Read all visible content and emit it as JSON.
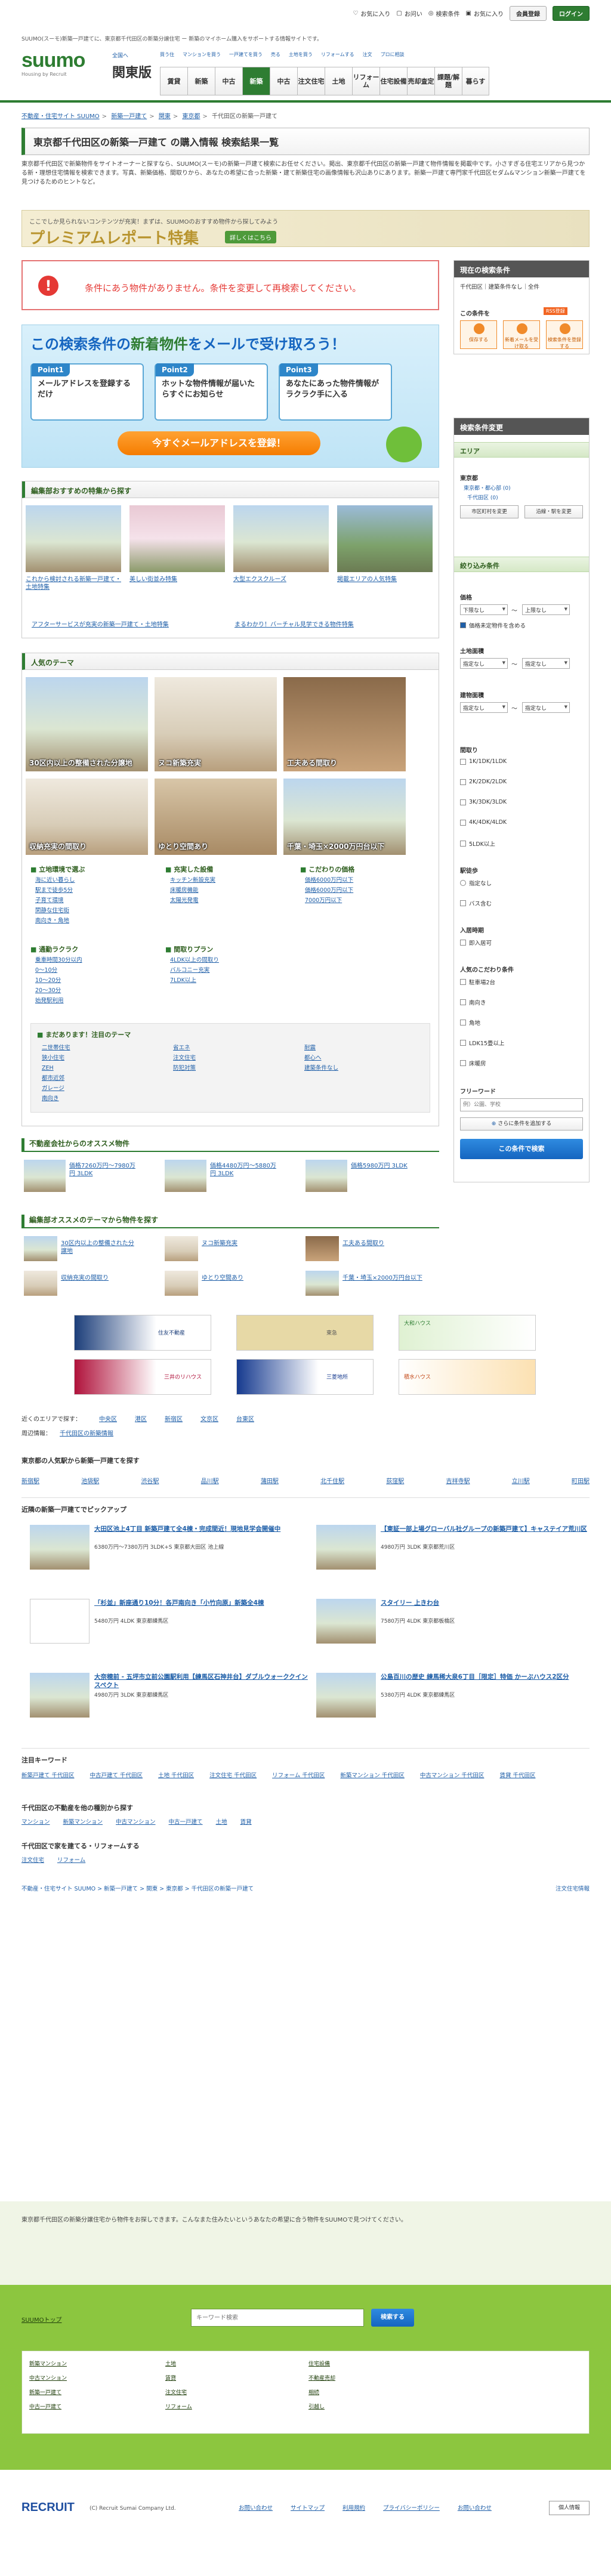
{
  "header": {
    "desc": "SUUMO(スーモ)新築一戸建てに、東京都千代田区の新築分譲住宅 ー 新築のマイホーム購入をサポートする情報サイトです。",
    "logo": "suumo",
    "logo_sub": "Housing by Recruit",
    "area_change": "全国へ",
    "area": "関東版",
    "links": [
      {
        "icon": "○",
        "label": "お気に入り"
      },
      {
        "icon": "□",
        "label": "お问い"
      },
      {
        "icon": "◎",
        "label": "検索条件"
      },
      {
        "icon": "▣",
        "label": "お気に入り"
      }
    ],
    "login_register": "会員登録",
    "login": "ログイン",
    "nav_top": [
      "買う住",
      "マンションを買う",
      "一戸建てを買う",
      "売る",
      "土地を買う",
      "リフォームする",
      "注文",
      "プロに相談"
    ],
    "nav": [
      "賃貸",
      "新築",
      "中古",
      "新築",
      "中古",
      "注文住宅",
      "土地",
      "リフォーム",
      "住宅設備",
      "売却査定",
      "課題/解題",
      "暮らす"
    ]
  },
  "breadcrumb": [
    "不動産・住宅サイト SUUMO",
    "新築一戸建て",
    "関東",
    "東京都",
    "千代田区の新築一戸建て"
  ],
  "title": "東京都千代田区の新築一戸建て の購入情報 検索結果一覧",
  "intro": "東京都千代田区で新築物件をサイトオーナーと探すなら、SUUMO(スーモ)の新築一戸建て検索にお任せください。掲出、東京都千代田区の新築一戸建て物件情報を掲載中です。小さすぎる住宅エリアから見つかる新・理想住宅情報を検索できます。写真、新築価格、間取りから、あなたの希望に合った新築・建て新築住宅の画像情報も沢山ありにあります。新築一戸建て専門家千代田区セダム&マンション新築一戸建てを見つけるためのヒントなど。",
  "premium": {
    "small": "ここでしか見られないコンテンツが充実！まずは、SUUMOのおすすめ物件から探してみよう",
    "big": "プレミアムレポート特集",
    "btn": "詳しくはこちら"
  },
  "warning": "条件にあう物件がありません。条件を変更して再検索してください。",
  "mail": {
    "title_a": "この検索条件の",
    "title_b": "新着物件",
    "title_c": "を",
    "title_d": "メール",
    "title_e": "で受け取ろう！",
    "points": [
      {
        "n": "Point1",
        "t": "メールアドレスを登録するだけ"
      },
      {
        "n": "Point2",
        "t": "ホットな物件情報が届いたらすぐにお知らせ"
      },
      {
        "n": "Point3",
        "t": "あなたにあった物件情報がラクラク手に入る"
      }
    ],
    "btn": "今すぐメールアドレスを登録！"
  },
  "features": {
    "heading": "編集部おすすめの特集から探す",
    "items": [
      "これから検討される新築一戸建て・土地特集",
      "美しい街並み特集",
      "大型エクスクルーズ",
      "掲載エリアの人気特集"
    ],
    "links": [
      "アフターサービスが充実の新築一戸建て・土地特集",
      "まるわかり！バーチャル見学できる物件特集"
    ]
  },
  "theme": {
    "heading": "人気のテーマ",
    "tiles": [
      "30区内以上の整備された分譲地",
      "ヌコ新築充実",
      "工夫ある間取り",
      "収納充実の間取り",
      "ゆとり空間あり",
      "千葉・埼玉×2000万円台以下"
    ],
    "groups": [
      {
        "h": "立地環境で選ぶ",
        "items": [
          "海に近い暮らし",
          "駅まで徒歩5分",
          "子育て環境",
          "閑静な住宅街",
          "南向き・角地"
        ]
      },
      {
        "h": "充実した設備",
        "items": [
          "キッチン新設充実",
          "床暖房機能",
          "太陽光発電"
        ]
      },
      {
        "h": "こだわりの価格",
        "items": [
          "価格6000万円以下",
          "価格6000万円以下",
          "7000万円以下"
        ]
      },
      {
        "h": "通勤ラクラク",
        "items": [
          "乗車時間30分以内",
          "0〜10分",
          "10〜20分",
          "20〜30分",
          "始発駅利用"
        ]
      },
      {
        "h": "間取りプラン",
        "items": [
          "4LDK以上の間取り",
          "バルコニー充実",
          "7LDK以上"
        ]
      }
    ],
    "also_h": "まだあります！注目のテーマ",
    "also": [
      "二世帯住宅",
      "狭小住宅",
      "ZEH",
      "都市近郊",
      "ガレージ",
      "南向き",
      "省エネ",
      "注文住宅",
      "防犯対策",
      "耐震",
      "都心へ",
      "建築条件なし"
    ]
  },
  "realtor": {
    "heading": "不動産会社からのオススメ物件",
    "items": [
      {
        "t": "価格7260万円〜7980万円 3LDK",
        "p": ""
      },
      {
        "t": "価格4480万円〜5880万円 3LDK",
        "p": ""
      },
      {
        "t": "価格5980万円 3LDK",
        "p": ""
      }
    ]
  },
  "ed_theme": {
    "heading": "編集部オススメのテーマから物件を探す",
    "items": [
      "30区内以上の整備された分譲地",
      "ヌコ新築充実",
      "工夫ある間取り",
      "収納充実の間取り",
      "ゆとり空間あり",
      "千葉・埼玉×2000万円台以下"
    ]
  },
  "ads": [
    "住友不動産",
    "東急",
    "大和ハウス",
    "三井のリハウス",
    "三菱地所",
    "積水ハウス"
  ],
  "nearby": {
    "label": "近くのエリアで探す：",
    "areas": [
      "中央区",
      "港区",
      "新宿区",
      "文京区",
      "台東区"
    ],
    "rel_label": "周辺情報：",
    "rel": "千代田区の新築情報"
  },
  "popular": {
    "heading": "東京都の人気駅から新築一戸建てを探す",
    "stations": [
      "新宿駅",
      "池袋駅",
      "渋谷駅",
      "品川駅",
      "蒲田駅",
      "北千住駅",
      "荻窪駅",
      "吉祥寺駅",
      "立川駅",
      "町田駅"
    ]
  },
  "picks": {
    "heading": "近隣の新築一戸建てでピックアップ",
    "items": [
      {
        "t": "大田区池上4丁目 新築戸建て全4棟・完成間近！現地見学会開催中",
        "d": "6380万円〜7380万円 3LDK+S 東京都大田区 池上線"
      },
      {
        "t": "【東証一部上場グローバル社グループの新築戸建て】キャステイア荒川区",
        "d": "4980万円 3LDK 東京都荒川区"
      },
      {
        "t": "「杉並」新座通り10分！各戸南向き「小竹向原」新築全4棟",
        "d": "5480万円 4LDK 東京都練馬区"
      },
      {
        "t": "スタイリー 上きわ台",
        "d": "7580万円 4LDK 東京都板橋区"
      },
      {
        "t": "大奈穂前 - 五坪市立前公園駅利用【練馬区石神井台】ダブルウォーククインスペクト",
        "d": "4980万円 3LDK 東京都練馬区"
      },
      {
        "t": "公島百川の歴史 練馬稀大泉6丁目［限定］特価 かーぶハウス2区分",
        "d": "5380万円 4LDK 東京都練馬区"
      }
    ]
  },
  "keywords": {
    "heading": "注目キーワード",
    "items": [
      "新築戸建て 千代田区",
      "中古戸建て 千代田区",
      "土地 千代田区",
      "注文住宅 千代田区",
      "リフォーム 千代田区",
      "新築マンション 千代田区",
      "中古マンション 千代田区",
      "賃貸 千代田区"
    ]
  },
  "other": {
    "heading": "千代田区の不動産を他の種別から探す",
    "items": [
      "マンション",
      "新築マンション",
      "中古マンション",
      "中古一戸建て",
      "土地",
      "賃貸"
    ]
  },
  "reform": {
    "heading": "千代田区で家を建てる・リフォームする",
    "items": [
      "注文住宅",
      "リフォーム"
    ]
  },
  "footer": {
    "crumb": "不動産・住宅サイト SUUMO > 新築一戸建て > 関東 > 東京都 > 千代田区の新築一戸建て",
    "desc": "東京都千代田区の新築分譲住宅から物件をお探しできます。こんなまた住みたいというあなたの希望に合う物件をSUUMOで見つけてください。",
    "search_placeholder": "キーワード検索",
    "search_btn": "検索する",
    "sitetop": "SUUMOトップ",
    "helplink": "注文住宅情報",
    "links": [
      "新築マンション",
      "中古マンション",
      "新築一戸建て",
      "中古一戸建て",
      "土地",
      "賃貸",
      "注文住宅",
      "リフォーム",
      "住宅設備",
      "不動産売却",
      "相続",
      "引越し"
    ],
    "recruit": "RECRUIT",
    "copy": "(C) Recruit Sumai Company Ltd.",
    "bottom": [
      "お問い合わせ",
      "サイトマップ",
      "利用規約",
      "プライバシーポリシー",
      "お問い合わせ"
    ],
    "badge": "個人情報"
  },
  "side": {
    "current_h": "現在の検索条件",
    "current": "千代田区｜建築条件なし｜全件",
    "this_cond": "この条件を",
    "rss": "RSS登録",
    "save_btns": [
      "保存する",
      "新着メールを受け取る",
      "検索条件を登録する"
    ],
    "change_h": "検索条件変更",
    "area_h": "エリア",
    "pref": "東京都",
    "area_items": [
      "東京都・都心部 (0)",
      "千代田区 (0)"
    ],
    "area_btn": "市区町村を変更",
    "line_btn": "沿線・駅を変更",
    "narrow_h": "絞り込み条件",
    "price_h": "価格",
    "price_from": "下限なし",
    "price_to": "上限なし",
    "price_cb": "価格未定物件を含める",
    "land_h": "土地面積",
    "land_from": "指定なし",
    "land_to": "指定なし",
    "bld_h": "建物面積",
    "bld_from": "指定なし",
    "bld_to": "指定なし",
    "plan_h": "間取り",
    "plans": [
      "1K/1DK/1LDK",
      "2K/2DK/2LDK",
      "3K/3DK/3LDK",
      "4K/4DK/4LDK",
      "5LDK以上"
    ],
    "walk_h": "駅徒歩",
    "walk": [
      "指定なし",
      "バス含む"
    ],
    "move_h": "入居時期",
    "move": [
      "即入居可"
    ],
    "pop_h": "人気のこだわり条件",
    "pops": [
      "駐車場2台",
      "南向き",
      "角地",
      "LDK15畳以上",
      "床暖房"
    ],
    "free_h": "フリーワード",
    "free_ph": "例）公園、学校",
    "more": "さらに条件を追加する",
    "go": "この条件で検索"
  }
}
